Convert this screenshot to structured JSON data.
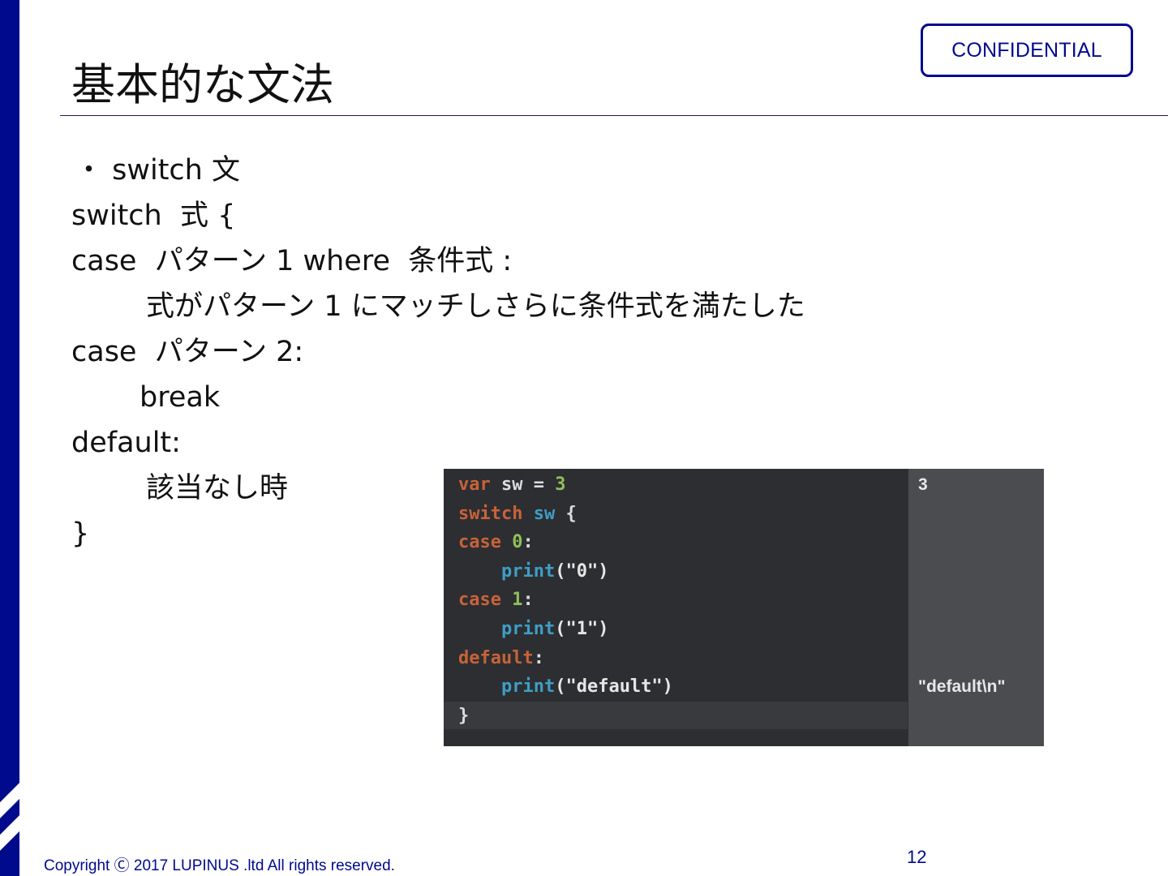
{
  "slide": {
    "title": "基本的な文法",
    "confidential_label": "CONFIDENTIAL",
    "body_lines": [
      "・ switch 文",
      "switch  式 {",
      "case  パターン 1 where  条件式 :",
      "式がパターン 1 にマッチしさらに条件式を満たした",
      "case  パターン 2:",
      "break",
      "default:",
      "該当なし時",
      "}"
    ],
    "code_panel": {
      "lines": [
        [
          {
            "t": "var",
            "c": "kw"
          },
          {
            "t": " sw = ",
            "c": "id"
          },
          {
            "t": "3",
            "c": "num"
          }
        ],
        [
          {
            "t": "switch",
            "c": "kw"
          },
          {
            "t": " ",
            "c": "id"
          },
          {
            "t": "sw",
            "c": "fn"
          },
          {
            "t": " {",
            "c": "id"
          }
        ],
        [
          {
            "t": "case",
            "c": "kw"
          },
          {
            "t": " ",
            "c": "id"
          },
          {
            "t": "0",
            "c": "num"
          },
          {
            "t": ":",
            "c": "id"
          }
        ],
        [
          {
            "t": "    ",
            "c": "id"
          },
          {
            "t": "print",
            "c": "fn"
          },
          {
            "t": "(\"0\")",
            "c": "str"
          }
        ],
        [
          {
            "t": "case",
            "c": "kw"
          },
          {
            "t": " ",
            "c": "id"
          },
          {
            "t": "1",
            "c": "num"
          },
          {
            "t": ":",
            "c": "id"
          }
        ],
        [
          {
            "t": "    ",
            "c": "id"
          },
          {
            "t": "print",
            "c": "fn"
          },
          {
            "t": "(\"1\")",
            "c": "str"
          }
        ],
        [
          {
            "t": "default",
            "c": "kw"
          },
          {
            "t": ":",
            "c": "id"
          }
        ],
        [
          {
            "t": "    ",
            "c": "id"
          },
          {
            "t": "print",
            "c": "fn"
          },
          {
            "t": "(\"default\")",
            "c": "str"
          }
        ],
        [
          {
            "t": "}",
            "c": "id"
          }
        ]
      ],
      "results": [
        {
          "line": 1,
          "text": "3"
        },
        {
          "line": 8,
          "text": "\"default\\n\""
        }
      ],
      "colors": {
        "keyword": "#c7633a",
        "number": "#8fc05a",
        "function": "#3e9ec6",
        "background": "#2d2e31",
        "results_background": "#4a4c4f"
      }
    },
    "footer": {
      "copyright": "Copyright Ⓒ 2017 LUPINUS .ltd All rights reserved.",
      "page_number": "12"
    },
    "accent_color": "#000a8c"
  }
}
